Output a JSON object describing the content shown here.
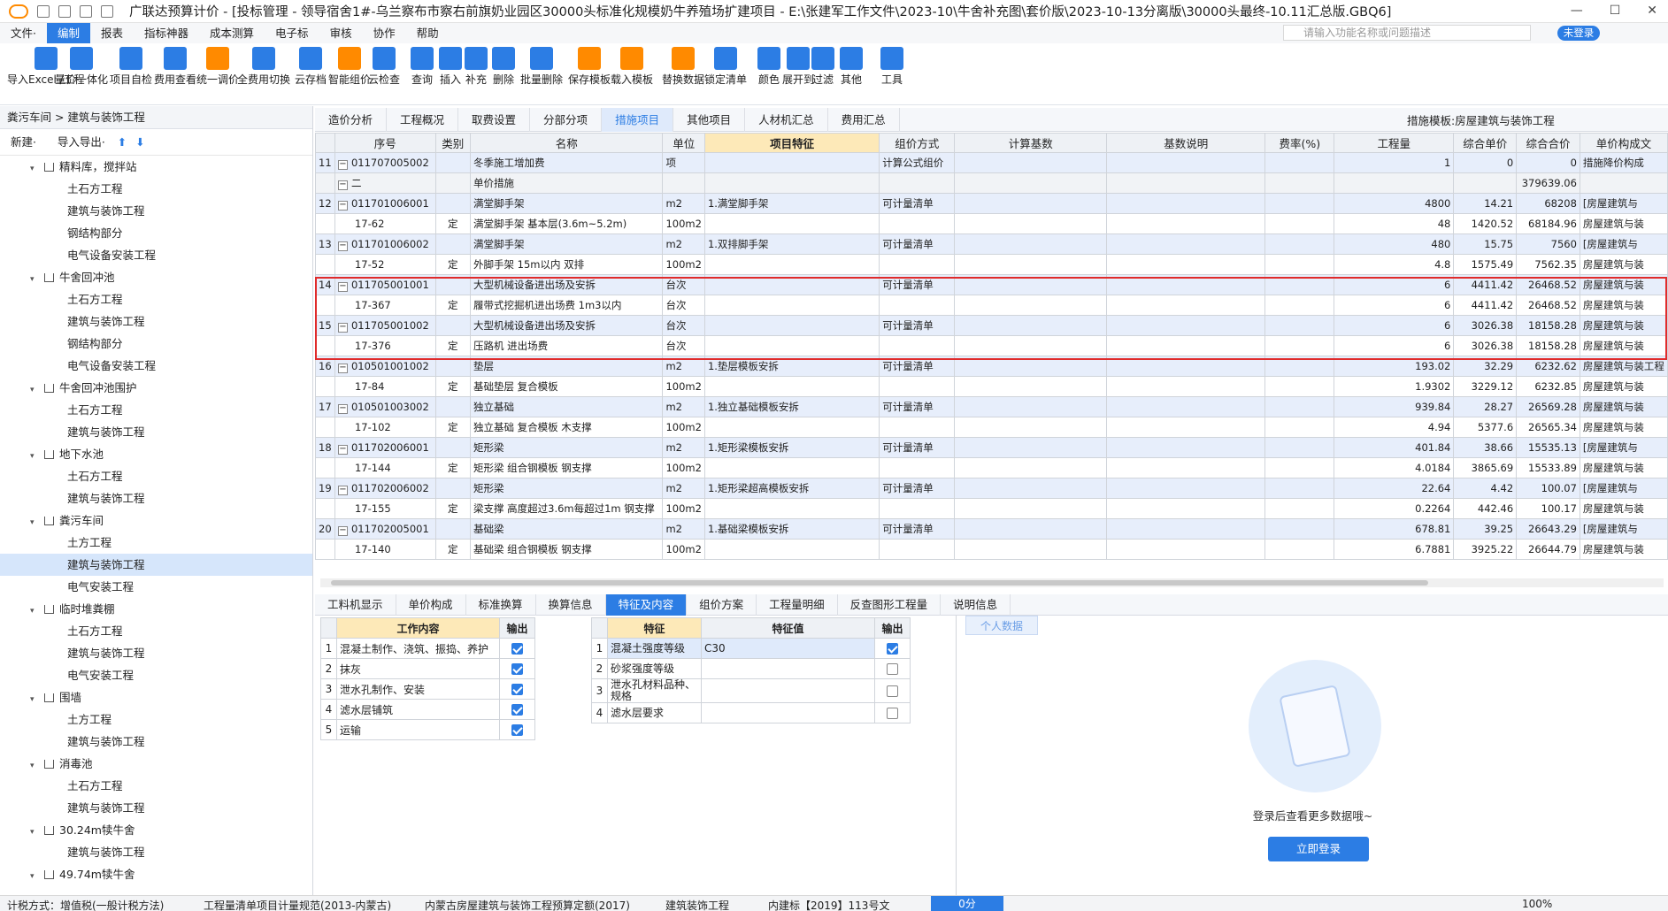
{
  "title": "广联达预算计价 - [投标管理 - 领导宿舍1#-乌兰察布市察右前旗奶业园区30000头标准化规模奶牛养殖场扩建项目 - E:\\张建军工作文件\\2023-10\\牛舍补充图\\套价版\\2023-10-13分离版\\30000头最终-10.11汇总版.GBQ6]",
  "menu": [
    "文件·",
    "编制",
    "报表",
    "指标神器",
    "成本测算",
    "电子标",
    "审核",
    "协作",
    "帮助"
  ],
  "search_placeholder": "请输入功能名称或问题描述",
  "login_badge": "未登录",
  "ribbon": [
    "导入Excel /工程",
    "量价一体化",
    "项目自检",
    "费用查看",
    "统一调价",
    "全费用切换",
    "云存档",
    "智能组价",
    "云检查",
    "查询",
    "插入",
    "补充",
    "删除",
    "批量删除",
    "保存模板",
    "载入模板",
    "替换数据",
    "锁定清单",
    "颜色",
    "展开到",
    "过滤",
    "其他",
    "工具"
  ],
  "left": {
    "breadcrumb": "粪污车间 > 建筑与装饰工程",
    "new_label": "新建·",
    "import_label": "导入导出·",
    "tree": [
      {
        "label": "精料库，搅拌站",
        "level": 1
      },
      {
        "label": "土石方工程",
        "level": 2
      },
      {
        "label": "建筑与装饰工程",
        "level": 2
      },
      {
        "label": "钢结构部分",
        "level": 2
      },
      {
        "label": "电气设备安装工程",
        "level": 2
      },
      {
        "label": "牛舍回冲池",
        "level": 1
      },
      {
        "label": "土石方工程",
        "level": 2
      },
      {
        "label": "建筑与装饰工程",
        "level": 2
      },
      {
        "label": "钢结构部分",
        "level": 2
      },
      {
        "label": "电气设备安装工程",
        "level": 2
      },
      {
        "label": "牛舍回冲池围护",
        "level": 1
      },
      {
        "label": "土石方工程",
        "level": 2
      },
      {
        "label": "建筑与装饰工程",
        "level": 2
      },
      {
        "label": "地下水池",
        "level": 1
      },
      {
        "label": "土石方工程",
        "level": 2
      },
      {
        "label": "建筑与装饰工程",
        "level": 2
      },
      {
        "label": "粪污车间",
        "level": 1
      },
      {
        "label": "土方工程",
        "level": 2
      },
      {
        "label": "建筑与装饰工程",
        "level": 2,
        "selected": true
      },
      {
        "label": "电气安装工程",
        "level": 2
      },
      {
        "label": "临时堆粪棚",
        "level": 1
      },
      {
        "label": "土石方工程",
        "level": 2
      },
      {
        "label": "建筑与装饰工程",
        "level": 2
      },
      {
        "label": "电气安装工程",
        "level": 2
      },
      {
        "label": "围墙",
        "level": 1
      },
      {
        "label": "土方工程",
        "level": 2
      },
      {
        "label": "建筑与装饰工程",
        "level": 2
      },
      {
        "label": "消毒池",
        "level": 1
      },
      {
        "label": "土石方工程",
        "level": 2
      },
      {
        "label": "建筑与装饰工程",
        "level": 2
      },
      {
        "label": "30.24m犊牛舍",
        "level": 1
      },
      {
        "label": "建筑与装饰工程",
        "level": 2
      },
      {
        "label": "49.74m犊牛舍",
        "level": 1
      }
    ]
  },
  "tabs": [
    "造价分析",
    "工程概况",
    "取费设置",
    "分部分项",
    "措施项目",
    "其他项目",
    "人材机汇总",
    "费用汇总"
  ],
  "active_tab": "措施项目",
  "template_label": "措施模板:房屋建筑与装饰工程",
  "grid": {
    "headers": [
      "序号",
      "类别",
      "名称",
      "单位",
      "项目特征",
      "组价方式",
      "计算基数",
      "基数说明",
      "费率(%)",
      "工程量",
      "综合单价",
      "综合合价",
      "单价构成文"
    ],
    "rows": [
      {
        "t": "main",
        "no": "11",
        "code": "011707005002",
        "cat": "",
        "name": "冬季施工增加费",
        "unit": "项",
        "feat": "",
        "method": "计算公式组价",
        "qty": "1",
        "price": "0",
        "total": "0",
        "comp": "措施降价构成"
      },
      {
        "t": "grp",
        "no": "",
        "code": "二",
        "cat": "",
        "name": "单价措施",
        "unit": "",
        "feat": "",
        "method": "",
        "qty": "",
        "price": "",
        "total": "379639.06",
        "comp": ""
      },
      {
        "t": "main",
        "no": "12",
        "code": "011701006001",
        "cat": "",
        "name": "满堂脚手架",
        "unit": "m2",
        "feat": "1.满堂脚手架",
        "method": "可计量清单",
        "qty": "4800",
        "price": "14.21",
        "total": "68208",
        "comp": "[房屋建筑与"
      },
      {
        "t": "sub",
        "no": "",
        "code": "17-62",
        "cat": "定",
        "name": "满堂脚手架 基本层(3.6m~5.2m)",
        "unit": "100m2",
        "feat": "",
        "method": "",
        "qty": "48",
        "price": "1420.52",
        "total": "68184.96",
        "comp": "房屋建筑与装"
      },
      {
        "t": "main",
        "no": "13",
        "code": "011701006002",
        "cat": "",
        "name": "满堂脚手架",
        "unit": "m2",
        "feat": "1.双排脚手架",
        "method": "可计量清单",
        "qty": "480",
        "price": "15.75",
        "total": "7560",
        "comp": "[房屋建筑与"
      },
      {
        "t": "sub",
        "no": "",
        "code": "17-52",
        "cat": "定",
        "name": "外脚手架 15m以内 双排",
        "unit": "100m2",
        "feat": "",
        "method": "",
        "qty": "4.8",
        "price": "1575.49",
        "total": "7562.35",
        "comp": "房屋建筑与装"
      },
      {
        "t": "main",
        "no": "14",
        "code": "011705001001",
        "cat": "",
        "name": "大型机械设备进出场及安拆",
        "unit": "台次",
        "feat": "",
        "method": "可计量清单",
        "qty": "6",
        "price": "4411.42",
        "total": "26468.52",
        "comp": "房屋建筑与装"
      },
      {
        "t": "sub",
        "no": "",
        "code": "17-367",
        "cat": "定",
        "name": "履带式挖掘机进出场费 1m3以内",
        "unit": "台次",
        "feat": "",
        "method": "",
        "qty": "6",
        "price": "4411.42",
        "total": "26468.52",
        "comp": "房屋建筑与装"
      },
      {
        "t": "main",
        "no": "15",
        "code": "011705001002",
        "cat": "",
        "name": "大型机械设备进出场及安拆",
        "unit": "台次",
        "feat": "",
        "method": "可计量清单",
        "qty": "6",
        "price": "3026.38",
        "total": "18158.28",
        "comp": "房屋建筑与装"
      },
      {
        "t": "sub",
        "no": "",
        "code": "17-376",
        "cat": "定",
        "name": "压路机 进出场费",
        "unit": "台次",
        "feat": "",
        "method": "",
        "qty": "6",
        "price": "3026.38",
        "total": "18158.28",
        "comp": "房屋建筑与装"
      },
      {
        "t": "main",
        "no": "16",
        "code": "010501001002",
        "cat": "",
        "name": "垫层",
        "unit": "m2",
        "feat": "1.垫层模板安拆",
        "method": "可计量清单",
        "qty": "193.02",
        "price": "32.29",
        "total": "6232.62",
        "comp": "房屋建筑与装工程"
      },
      {
        "t": "sub",
        "no": "",
        "code": "17-84",
        "cat": "定",
        "name": "基础垫层 复合模板",
        "unit": "100m2",
        "feat": "",
        "method": "",
        "qty": "1.9302",
        "price": "3229.12",
        "total": "6232.85",
        "comp": "房屋建筑与装"
      },
      {
        "t": "main",
        "no": "17",
        "code": "010501003002",
        "cat": "",
        "name": "独立基础",
        "unit": "m2",
        "feat": "1.独立基础模板安拆",
        "method": "可计量清单",
        "qty": "939.84",
        "price": "28.27",
        "total": "26569.28",
        "comp": "房屋建筑与装"
      },
      {
        "t": "sub",
        "no": "",
        "code": "17-102",
        "cat": "定",
        "name": "独立基础 复合模板 木支撑",
        "unit": "100m2",
        "feat": "",
        "method": "",
        "qty": "4.94",
        "price": "5377.6",
        "total": "26565.34",
        "comp": "房屋建筑与装"
      },
      {
        "t": "main",
        "no": "18",
        "code": "011702006001",
        "cat": "",
        "name": "矩形梁",
        "unit": "m2",
        "feat": "1.矩形梁模板安拆",
        "method": "可计量清单",
        "qty": "401.84",
        "price": "38.66",
        "total": "15535.13",
        "comp": "[房屋建筑与"
      },
      {
        "t": "sub",
        "no": "",
        "code": "17-144",
        "cat": "定",
        "name": "矩形梁 组合钢模板 钢支撑",
        "unit": "100m2",
        "feat": "",
        "method": "",
        "qty": "4.0184",
        "price": "3865.69",
        "total": "15533.89",
        "comp": "房屋建筑与装"
      },
      {
        "t": "main",
        "no": "19",
        "code": "011702006002",
        "cat": "",
        "name": "矩形梁",
        "unit": "m2",
        "feat": "1.矩形梁超高模板安拆",
        "method": "可计量清单",
        "qty": "22.64",
        "price": "4.42",
        "total": "100.07",
        "comp": "[房屋建筑与"
      },
      {
        "t": "sub",
        "no": "",
        "code": "17-155",
        "cat": "定",
        "name": "梁支撑 高度超过3.6m每超过1m 钢支撑",
        "unit": "100m2",
        "feat": "",
        "method": "",
        "qty": "0.2264",
        "price": "442.46",
        "total": "100.17",
        "comp": "房屋建筑与装"
      },
      {
        "t": "main",
        "no": "20",
        "code": "011702005001",
        "cat": "",
        "name": "基础梁",
        "unit": "m2",
        "feat": "1.基础梁模板安拆",
        "method": "可计量清单",
        "qty": "678.81",
        "price": "39.25",
        "total": "26643.29",
        "comp": "[房屋建筑与"
      },
      {
        "t": "sub",
        "no": "",
        "code": "17-140",
        "cat": "定",
        "name": "基础梁 组合钢模板 钢支撑",
        "unit": "100m2",
        "feat": "",
        "method": "",
        "qty": "6.7881",
        "price": "3925.22",
        "total": "26644.79",
        "comp": "房屋建筑与装"
      }
    ]
  },
  "bottom_tabs": [
    "工料机显示",
    "单价构成",
    "标准换算",
    "换算信息",
    "特征及内容",
    "组价方案",
    "工程量明细",
    "反查图形工程量",
    "说明信息"
  ],
  "active_bottom_tab": "特征及内容",
  "work": {
    "headers": [
      "工作内容",
      "输出"
    ],
    "rows": [
      {
        "label": "混凝土制作、浇筑、振捣、养护",
        "checked": true
      },
      {
        "label": "抹灰",
        "checked": true
      },
      {
        "label": "泄水孔制作、安装",
        "checked": true
      },
      {
        "label": "滤水层铺筑",
        "checked": true
      },
      {
        "label": "运输",
        "checked": true
      }
    ]
  },
  "features": {
    "headers": [
      "特征",
      "特征值",
      "输出"
    ],
    "rows": [
      {
        "label": "混凝土强度等级",
        "value": "C30",
        "checked": true
      },
      {
        "label": "砂浆强度等级",
        "value": "",
        "checked": false
      },
      {
        "label": "泄水孔材料品种、规格",
        "value": "",
        "checked": false
      },
      {
        "label": "滤水层要求",
        "value": "",
        "checked": false
      }
    ]
  },
  "personal": {
    "tab": "个人数据",
    "tip": "登录后查看更多数据哦~",
    "button": "立即登录"
  },
  "status": {
    "tax": "计税方式：增值税(一般计税方法)",
    "rule": "工程量清单项目计量规范(2013-内蒙古)",
    "quota": "内蒙古房屋建筑与装饰工程预算定额(2017)",
    "kind": "建筑装饰工程",
    "doc": "内建标【2019】113号文",
    "price": "0分",
    "zoom": "100%"
  }
}
